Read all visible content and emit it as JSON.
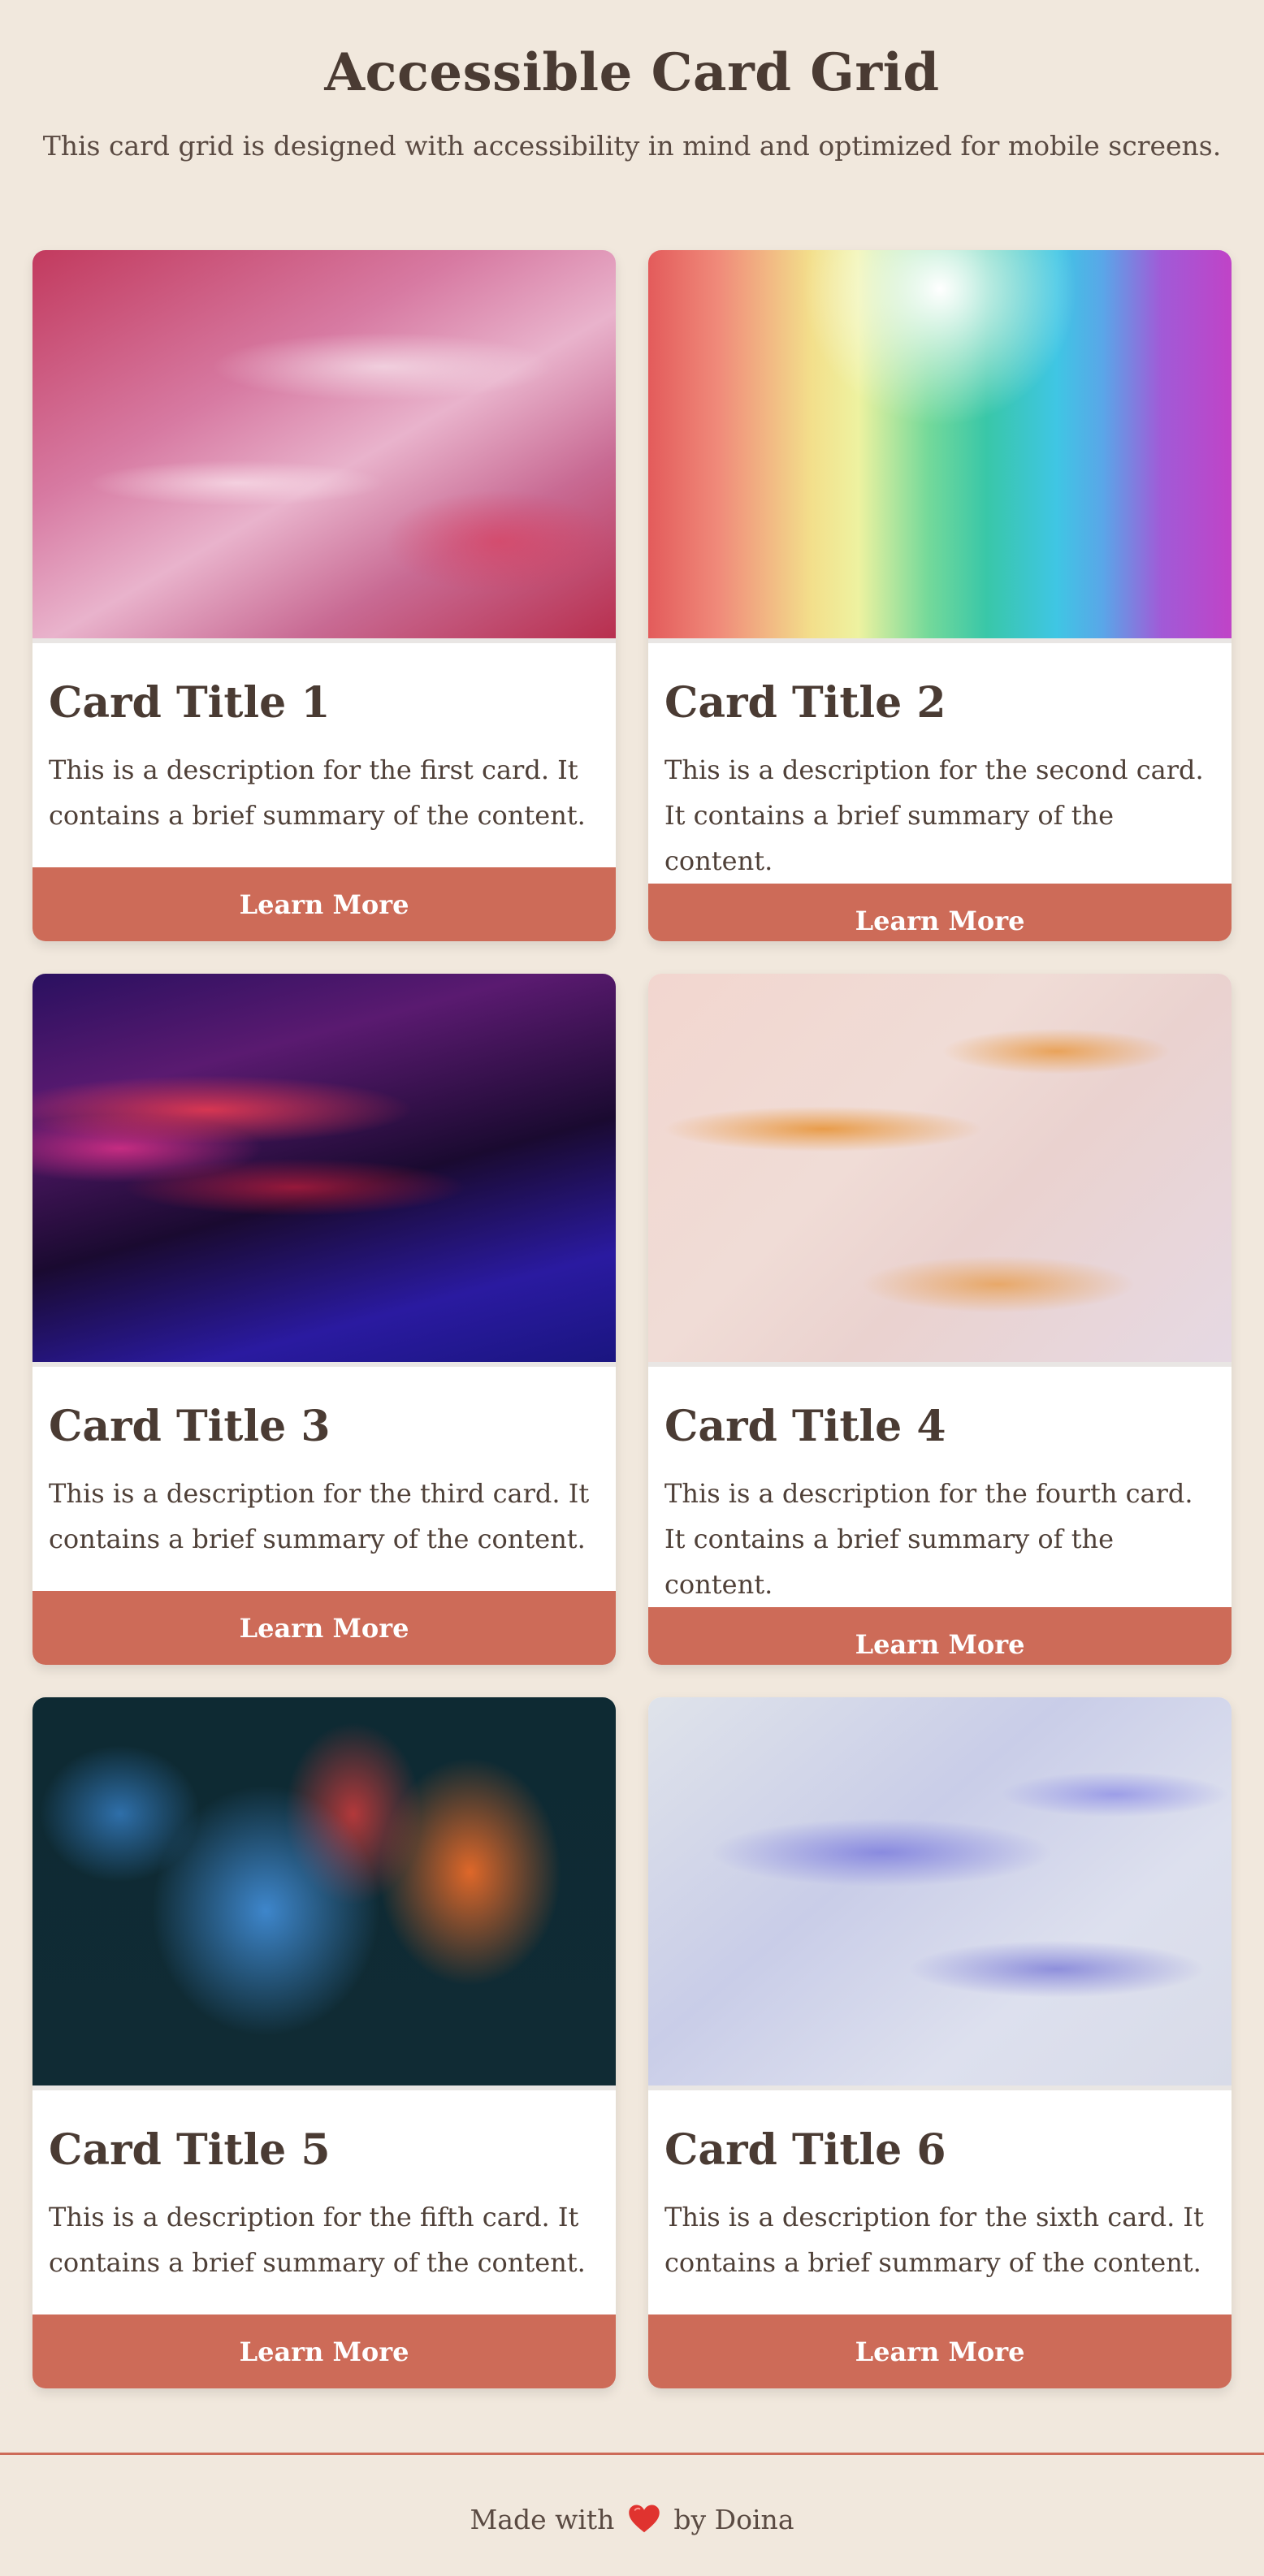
{
  "header": {
    "title": "Accessible Card Grid",
    "subtitle": "This card grid is designed with accessibility in mind and optimized for mobile screens."
  },
  "cards": [
    {
      "title": "Card Title 1",
      "description": "This is a description for the first card. It contains a brief summary of the content.",
      "button": "Learn More"
    },
    {
      "title": "Card Title 2",
      "description": "This is a description for the second card. It contains a brief summary of the content.",
      "button": "Learn More"
    },
    {
      "title": "Card Title 3",
      "description": "This is a description for the third card. It contains a brief summary of the content.",
      "button": "Learn More"
    },
    {
      "title": "Card Title 4",
      "description": "This is a description for the fourth card. It contains a brief summary of the content.",
      "button": "Learn More"
    },
    {
      "title": "Card Title 5",
      "description": "This is a description for the fifth card. It contains a brief summary of the content.",
      "button": "Learn More"
    },
    {
      "title": "Card Title 6",
      "description": "This is a description for the sixth card. It contains a brief summary of the content.",
      "button": "Learn More"
    }
  ],
  "footer": {
    "prefix": "Made with",
    "icon": "heart-icon",
    "suffix": "by Doina"
  },
  "colors": {
    "background": "#f1e8dd",
    "accent": "#cd6b58",
    "text": "#4a3b33"
  }
}
